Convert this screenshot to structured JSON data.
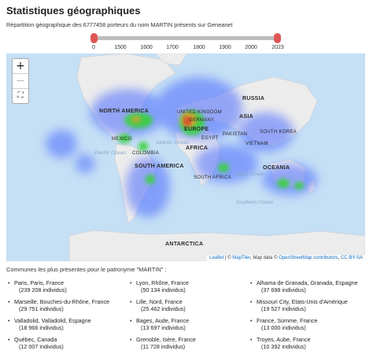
{
  "title": "Statistiques géographiques",
  "subtitle": "Répartition géographique des 6777458 porteurs du nom MARTIN présents sur Geneanet",
  "slider": {
    "ticks": [
      "0",
      "1500",
      "1600",
      "1700",
      "1800",
      "1900",
      "2000",
      "2023"
    ],
    "range": [
      "0",
      "2023"
    ],
    "accent": "#e05555"
  },
  "map": {
    "zoom_in": "+",
    "zoom_out": "−",
    "fullscreen_icon": "fullscreen-icon",
    "labels": {
      "north_america": "NORTH AMERICA",
      "europe": "EUROPE",
      "asia": "ASIA",
      "russia": "RUSSIA",
      "africa": "AFRICA",
      "south_america": "SOUTH AMERICA",
      "oceania": "OCEANIA",
      "antarctica": "ANTARCTICA",
      "united_kingdom": "UNITED KINGDOM",
      "germany": "GERMANY",
      "pakistan": "PAKISTAN",
      "south_korea": "SOUTH KOREA",
      "vietnam": "VIETNAM",
      "mexico": "MEXICO",
      "colombia": "COLOMBIA",
      "egypt": "EGYPT",
      "south_africa": "SOUTH AFRICA"
    },
    "seas": {
      "pacific": "Pacific Ocean",
      "atlantic": "Atlantic Ocean",
      "indian": "Indian Ocean",
      "southern": "Southern Ocean"
    },
    "attribution": {
      "leaflet": "Leaflet",
      "sep1": " | © ",
      "maptiler": "MapTiler",
      "sep2": ", Map data © ",
      "osm": "OpenStreetMap contributors",
      "sep3": ", ",
      "license": "CC-BY-SA"
    }
  },
  "communes": {
    "title": "Communes les plus présentes pour le patronyme \"MARTIN\" :",
    "columns": [
      [
        {
          "place": "Paris, Paris, France",
          "count": "(239 208 individus)"
        },
        {
          "place": "Marseille, Bouches-du-Rhône, France",
          "count": "(29 751 individus)"
        },
        {
          "place": "Valladolid, Valladolid, Espagne",
          "count": "(18 966 individus)"
        },
        {
          "place": "Québec, Canada",
          "count": "(12 007 individus)"
        }
      ],
      [
        {
          "place": "Lyon, Rhône, France",
          "count": "(50 134 individus)"
        },
        {
          "place": "Lille, Nord, France",
          "count": "(25 462 individus)"
        },
        {
          "place": "Bages, Aude, France",
          "count": "(13 697 individus)"
        },
        {
          "place": "Grenoble, Isère, France",
          "count": "(11 728 individus)"
        }
      ],
      [
        {
          "place": "Alhama de Granada, Granada, Espagne",
          "count": "(37 698 individus)"
        },
        {
          "place": "Missouri City, Etats-Unis d'Amérique",
          "count": "(19 527 individus)"
        },
        {
          "place": "France, Somme, France",
          "count": "(13 000 individus)"
        },
        {
          "place": "Troyes, Aube, France",
          "count": "(10 392 individus)"
        }
      ]
    ]
  }
}
